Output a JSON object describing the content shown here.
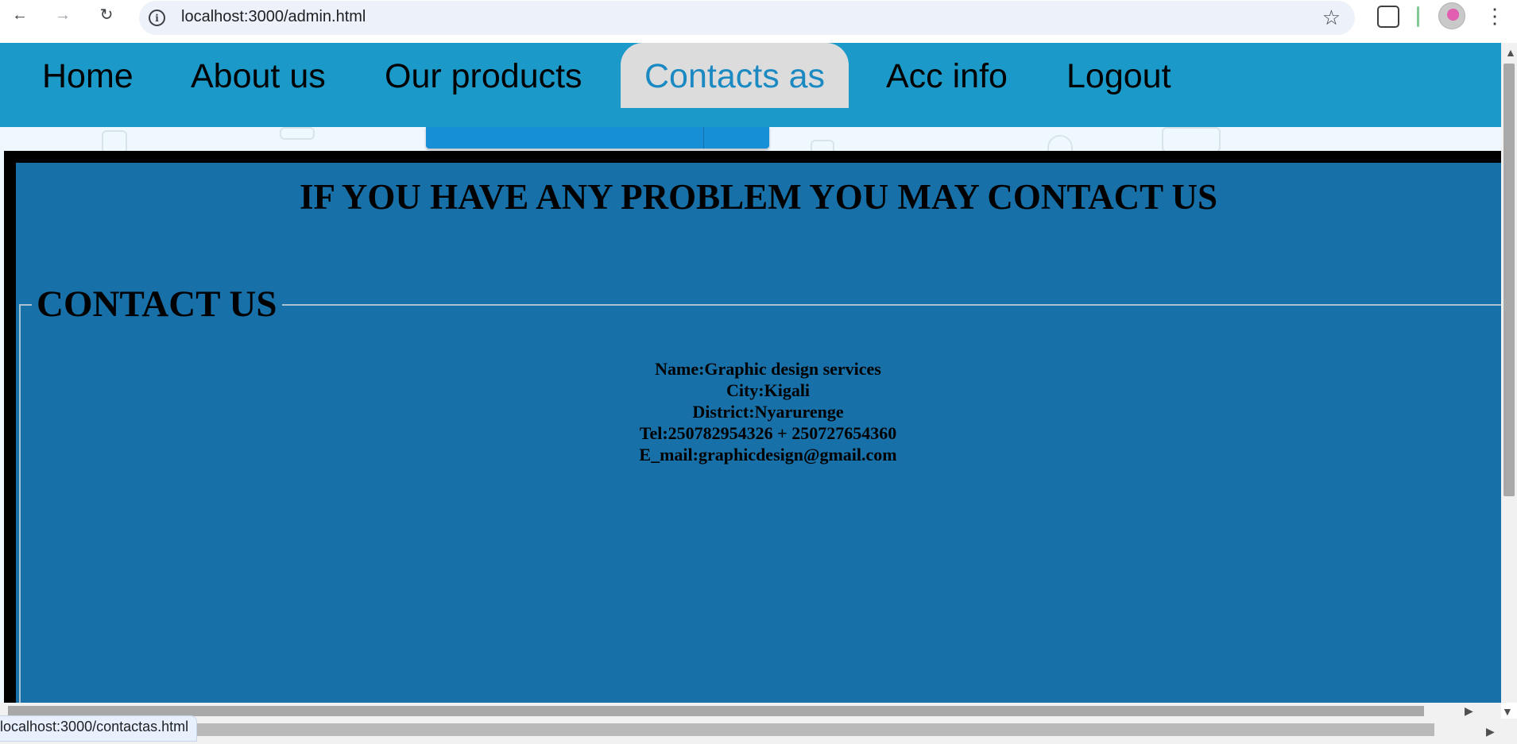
{
  "browser": {
    "url": "localhost:3000/admin.html",
    "status_url": "localhost:3000/contactas.html"
  },
  "nav": {
    "items": [
      "Home",
      "About us",
      "Our products",
      "Contacts as",
      "Acc info",
      "Logout"
    ],
    "active": "Contacts as"
  },
  "main": {
    "headline": "IF YOU HAVE ANY PROBLEM YOU MAY CONTACT US",
    "legend": "CONTACT US",
    "contact": {
      "name": "Name:Graphic design services",
      "city": "City:Kigali",
      "district": "District:Nyarurenge",
      "tel": "Tel:250782954326 + 250727654360",
      "email": "E_mail:graphicdesign@gmail.com"
    }
  },
  "colors": {
    "navbar": "#1b9ac9",
    "active_tab_bg": "#dcdcdc",
    "active_tab_text": "#1b8ac2",
    "content_bg": "#1770a8",
    "content_border": "#000000"
  },
  "icons": [
    "back-arrow-icon",
    "forward-arrow-icon",
    "reload-icon",
    "site-info-icon",
    "bookmark-star-icon",
    "extensions-icon",
    "profile-avatar",
    "menu-kebab-icon"
  ]
}
